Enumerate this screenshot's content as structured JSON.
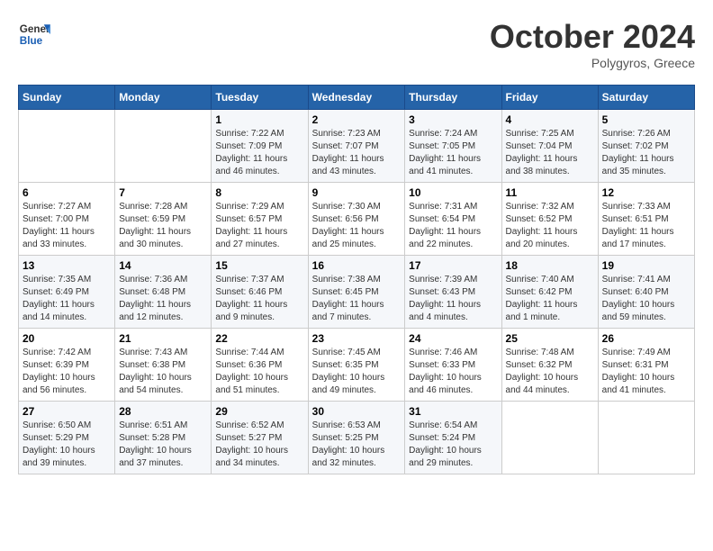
{
  "logo": {
    "line1": "General",
    "line2": "Blue"
  },
  "title": "October 2024",
  "subtitle": "Polygyros, Greece",
  "days_of_week": [
    "Sunday",
    "Monday",
    "Tuesday",
    "Wednesday",
    "Thursday",
    "Friday",
    "Saturday"
  ],
  "weeks": [
    [
      {
        "day": "",
        "content": ""
      },
      {
        "day": "",
        "content": ""
      },
      {
        "day": "1",
        "content": "Sunrise: 7:22 AM\nSunset: 7:09 PM\nDaylight: 11 hours and 46 minutes."
      },
      {
        "day": "2",
        "content": "Sunrise: 7:23 AM\nSunset: 7:07 PM\nDaylight: 11 hours and 43 minutes."
      },
      {
        "day": "3",
        "content": "Sunrise: 7:24 AM\nSunset: 7:05 PM\nDaylight: 11 hours and 41 minutes."
      },
      {
        "day": "4",
        "content": "Sunrise: 7:25 AM\nSunset: 7:04 PM\nDaylight: 11 hours and 38 minutes."
      },
      {
        "day": "5",
        "content": "Sunrise: 7:26 AM\nSunset: 7:02 PM\nDaylight: 11 hours and 35 minutes."
      }
    ],
    [
      {
        "day": "6",
        "content": "Sunrise: 7:27 AM\nSunset: 7:00 PM\nDaylight: 11 hours and 33 minutes."
      },
      {
        "day": "7",
        "content": "Sunrise: 7:28 AM\nSunset: 6:59 PM\nDaylight: 11 hours and 30 minutes."
      },
      {
        "day": "8",
        "content": "Sunrise: 7:29 AM\nSunset: 6:57 PM\nDaylight: 11 hours and 27 minutes."
      },
      {
        "day": "9",
        "content": "Sunrise: 7:30 AM\nSunset: 6:56 PM\nDaylight: 11 hours and 25 minutes."
      },
      {
        "day": "10",
        "content": "Sunrise: 7:31 AM\nSunset: 6:54 PM\nDaylight: 11 hours and 22 minutes."
      },
      {
        "day": "11",
        "content": "Sunrise: 7:32 AM\nSunset: 6:52 PM\nDaylight: 11 hours and 20 minutes."
      },
      {
        "day": "12",
        "content": "Sunrise: 7:33 AM\nSunset: 6:51 PM\nDaylight: 11 hours and 17 minutes."
      }
    ],
    [
      {
        "day": "13",
        "content": "Sunrise: 7:35 AM\nSunset: 6:49 PM\nDaylight: 11 hours and 14 minutes."
      },
      {
        "day": "14",
        "content": "Sunrise: 7:36 AM\nSunset: 6:48 PM\nDaylight: 11 hours and 12 minutes."
      },
      {
        "day": "15",
        "content": "Sunrise: 7:37 AM\nSunset: 6:46 PM\nDaylight: 11 hours and 9 minutes."
      },
      {
        "day": "16",
        "content": "Sunrise: 7:38 AM\nSunset: 6:45 PM\nDaylight: 11 hours and 7 minutes."
      },
      {
        "day": "17",
        "content": "Sunrise: 7:39 AM\nSunset: 6:43 PM\nDaylight: 11 hours and 4 minutes."
      },
      {
        "day": "18",
        "content": "Sunrise: 7:40 AM\nSunset: 6:42 PM\nDaylight: 11 hours and 1 minute."
      },
      {
        "day": "19",
        "content": "Sunrise: 7:41 AM\nSunset: 6:40 PM\nDaylight: 10 hours and 59 minutes."
      }
    ],
    [
      {
        "day": "20",
        "content": "Sunrise: 7:42 AM\nSunset: 6:39 PM\nDaylight: 10 hours and 56 minutes."
      },
      {
        "day": "21",
        "content": "Sunrise: 7:43 AM\nSunset: 6:38 PM\nDaylight: 10 hours and 54 minutes."
      },
      {
        "day": "22",
        "content": "Sunrise: 7:44 AM\nSunset: 6:36 PM\nDaylight: 10 hours and 51 minutes."
      },
      {
        "day": "23",
        "content": "Sunrise: 7:45 AM\nSunset: 6:35 PM\nDaylight: 10 hours and 49 minutes."
      },
      {
        "day": "24",
        "content": "Sunrise: 7:46 AM\nSunset: 6:33 PM\nDaylight: 10 hours and 46 minutes."
      },
      {
        "day": "25",
        "content": "Sunrise: 7:48 AM\nSunset: 6:32 PM\nDaylight: 10 hours and 44 minutes."
      },
      {
        "day": "26",
        "content": "Sunrise: 7:49 AM\nSunset: 6:31 PM\nDaylight: 10 hours and 41 minutes."
      }
    ],
    [
      {
        "day": "27",
        "content": "Sunrise: 6:50 AM\nSunset: 5:29 PM\nDaylight: 10 hours and 39 minutes."
      },
      {
        "day": "28",
        "content": "Sunrise: 6:51 AM\nSunset: 5:28 PM\nDaylight: 10 hours and 37 minutes."
      },
      {
        "day": "29",
        "content": "Sunrise: 6:52 AM\nSunset: 5:27 PM\nDaylight: 10 hours and 34 minutes."
      },
      {
        "day": "30",
        "content": "Sunrise: 6:53 AM\nSunset: 5:25 PM\nDaylight: 10 hours and 32 minutes."
      },
      {
        "day": "31",
        "content": "Sunrise: 6:54 AM\nSunset: 5:24 PM\nDaylight: 10 hours and 29 minutes."
      },
      {
        "day": "",
        "content": ""
      },
      {
        "day": "",
        "content": ""
      }
    ]
  ]
}
